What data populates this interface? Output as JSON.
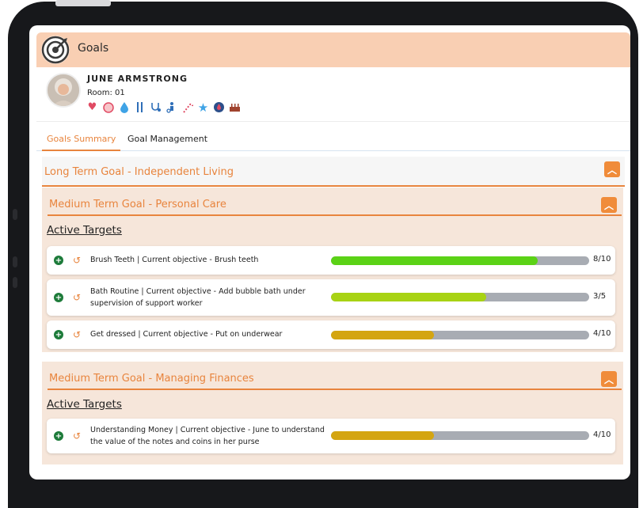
{
  "colors": {
    "accent": "#e8843d",
    "header_bg": "#f9cfb3",
    "bar_track": "#a8acb3"
  },
  "app": {
    "title": "Goals",
    "logo_icon": "target-icon"
  },
  "profile": {
    "name": "JUNE ARMSTRONG",
    "room": "Room: 01",
    "status_icons": [
      "heart-icon",
      "circle-icon",
      "water-drop-icon",
      "cutlery-icon",
      "stethoscope-icon",
      "mobility-icon",
      "candy-cane-icon",
      "star-icon",
      "blood-icon",
      "cake-icon"
    ]
  },
  "tabs": [
    {
      "label": "Goals Summary",
      "active": true
    },
    {
      "label": "Goal Management",
      "active": false
    }
  ],
  "long_term_goal": {
    "label": "Long Term Goal - Independent Living"
  },
  "medium_goals": [
    {
      "label": "Medium Term Goal - Personal Care",
      "targets_heading": "Active Targets",
      "targets": [
        {
          "text": "Brush Teeth | Current objective - Brush teeth",
          "done": 8,
          "total": 10,
          "progress_label": "8/10",
          "color": "#5bd216"
        },
        {
          "text": "Bath Routine | Current objective - Add bubble bath under supervision of support worker",
          "done": 3,
          "total": 5,
          "progress_label": "3/5",
          "color": "#a8d314"
        },
        {
          "text": "Get dressed | Current objective - Put on underwear",
          "done": 4,
          "total": 10,
          "progress_label": "4/10",
          "color": "#d4a511"
        }
      ]
    },
    {
      "label": "Medium Term Goal - Managing Finances",
      "targets_heading": "Active Targets",
      "targets": [
        {
          "text": "Understanding Money | Current objective - June to understand the value of the notes and coins in her purse",
          "done": 4,
          "total": 10,
          "progress_label": "4/10",
          "color": "#d4a511"
        }
      ]
    }
  ]
}
